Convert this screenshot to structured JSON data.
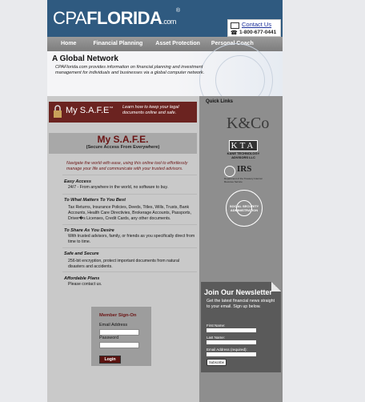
{
  "header": {
    "logo_cpa": "CPA",
    "logo_florida": "FLORIDA",
    "logo_com": ".com",
    "logo_reg": "®",
    "contact_label": "Contact Us",
    "phone": "1-800-677-0441",
    "phone_icon": "☎"
  },
  "nav": {
    "items": [
      "Home",
      "Financial Planning",
      "Asset Protection",
      "Personal Coach"
    ]
  },
  "banner": {
    "title": "A Global Network",
    "text": "CPAFlorida.com provides information on financial planning and investment management for individuals and businesses via a global computer network."
  },
  "safe_banner": {
    "title": "My S.A.F.E",
    "tm": "™",
    "tagline": "Learn how to keep your legal documents online and safe."
  },
  "safe": {
    "title": "My S.A.F.E.",
    "subtitle": "(Secure Access From Everywhere)",
    "intro": "Navigate the world with ease, using this online tool to effortlessly manage your life and communicate with your trusted advisors.",
    "sections": [
      {
        "heading": "Easy Access",
        "body": "24/7 - From anywhere in the world, no software to buy."
      },
      {
        "heading": "To What Matters To You Best",
        "body": "Tax Returns, Insurance Policies, Deeds, Titles, Wills, Trusts, Bank Accounts, Health Care Directivies, Brokerage Accounts, Passports, Driver�s Licenses, Credit Cards, any other documents."
      },
      {
        "heading": "To Share As You Desire",
        "body": "With trusted advisors, family, or friends as you specifically direct from time to time."
      },
      {
        "heading": "Safe and Secure",
        "body": "256-bit encryption, protect important documents from natural disasters and accidents."
      },
      {
        "heading": "Affordable Plans",
        "body": "Please contact us."
      }
    ]
  },
  "member": {
    "heading": "Member Sign-On",
    "email_label": "Email Address",
    "password_label": "Password",
    "login": "Login"
  },
  "quick_links": {
    "heading": "Quick Links",
    "k_logo": "K&Co",
    "kta": "KTA",
    "kta_sub": "KANE TECHNOLOGY ADVISORS LLC",
    "irs": "IRS",
    "irs_sub": "Department of the Treasury Internal Revenue Service",
    "ssa": "SOCIAL SECURITY ADMINISTRATION"
  },
  "newsletter": {
    "title": "Join Our Newsletter",
    "text": "Get the latest financial news straight to your email. Sign up below.",
    "first_name": "First Name:",
    "last_name": "Last Name:",
    "email": "Email Address (required):",
    "subscribe": "Subscribe"
  }
}
